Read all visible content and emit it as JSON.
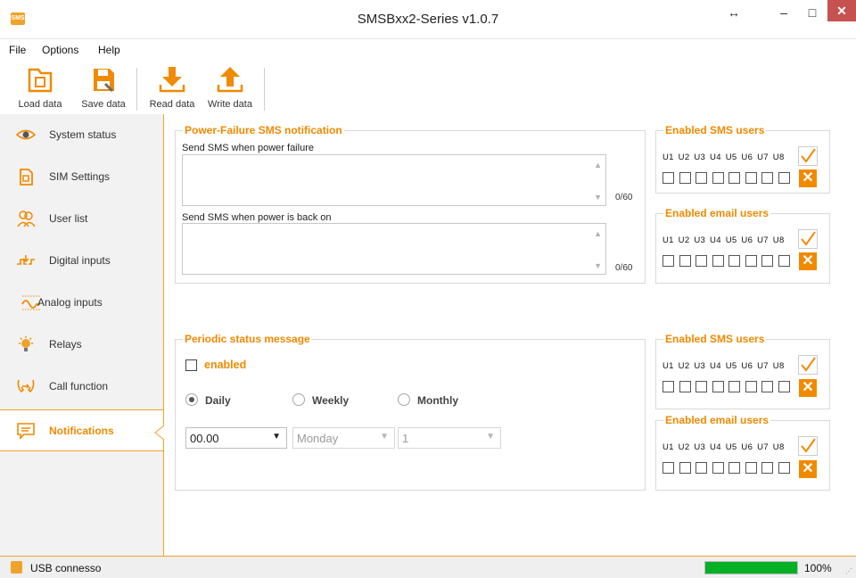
{
  "window": {
    "title": "SMSBxx2-Series v1.0.7",
    "app_icon_text": "SMS",
    "controls": {
      "resize": "↔",
      "minimize": "–",
      "maximize": "□",
      "close": "✕"
    }
  },
  "menu": {
    "file": "File",
    "options": "Options",
    "help": "Help"
  },
  "toolbar": {
    "load": "Load data",
    "save": "Save data",
    "read": "Read data",
    "write": "Write data"
  },
  "sidebar": {
    "items": [
      {
        "label": "System status",
        "icon": "eye-icon"
      },
      {
        "label": "SIM Settings",
        "icon": "sim-card-icon"
      },
      {
        "label": "User list",
        "icon": "users-icon"
      },
      {
        "label": "Digital inputs",
        "icon": "digital-input-icon"
      },
      {
        "label": "Analog inputs",
        "icon": "analog-wave-icon"
      },
      {
        "label": "Relays",
        "icon": "lightbulb-icon"
      },
      {
        "label": "Call function",
        "icon": "call-forward-icon"
      },
      {
        "label": "Notifications",
        "icon": "message-icon"
      }
    ],
    "active_index": 7
  },
  "power_failure": {
    "legend": "Power-Failure SMS notification",
    "fail_label": "Send SMS when power failure",
    "fail_text": "",
    "fail_counter": "0/60",
    "back_label": "Send SMS when power is back on",
    "back_text": "",
    "back_counter": "0/60"
  },
  "user_groups": {
    "users_header": "U1 U2 U3 U4 U5 U6 U7 U8",
    "sms_legend": "Enabled SMS users",
    "email_legend": "Enabled email users"
  },
  "periodic": {
    "legend": "Periodic status message",
    "enabled_label": "enabled",
    "enabled_checked": false,
    "radios": {
      "daily": "Daily",
      "weekly": "Weekly",
      "monthly": "Monthly"
    },
    "selected_radio": "Daily",
    "time_value": "00.00",
    "day_value": "Monday",
    "month_day_value": "1"
  },
  "status": {
    "connection": "USB connesso",
    "progress_fraction": 1.0,
    "progress_text": "100%"
  },
  "colors": {
    "accent": "#f08a00",
    "progress": "#06b025",
    "close": "#c75050"
  }
}
